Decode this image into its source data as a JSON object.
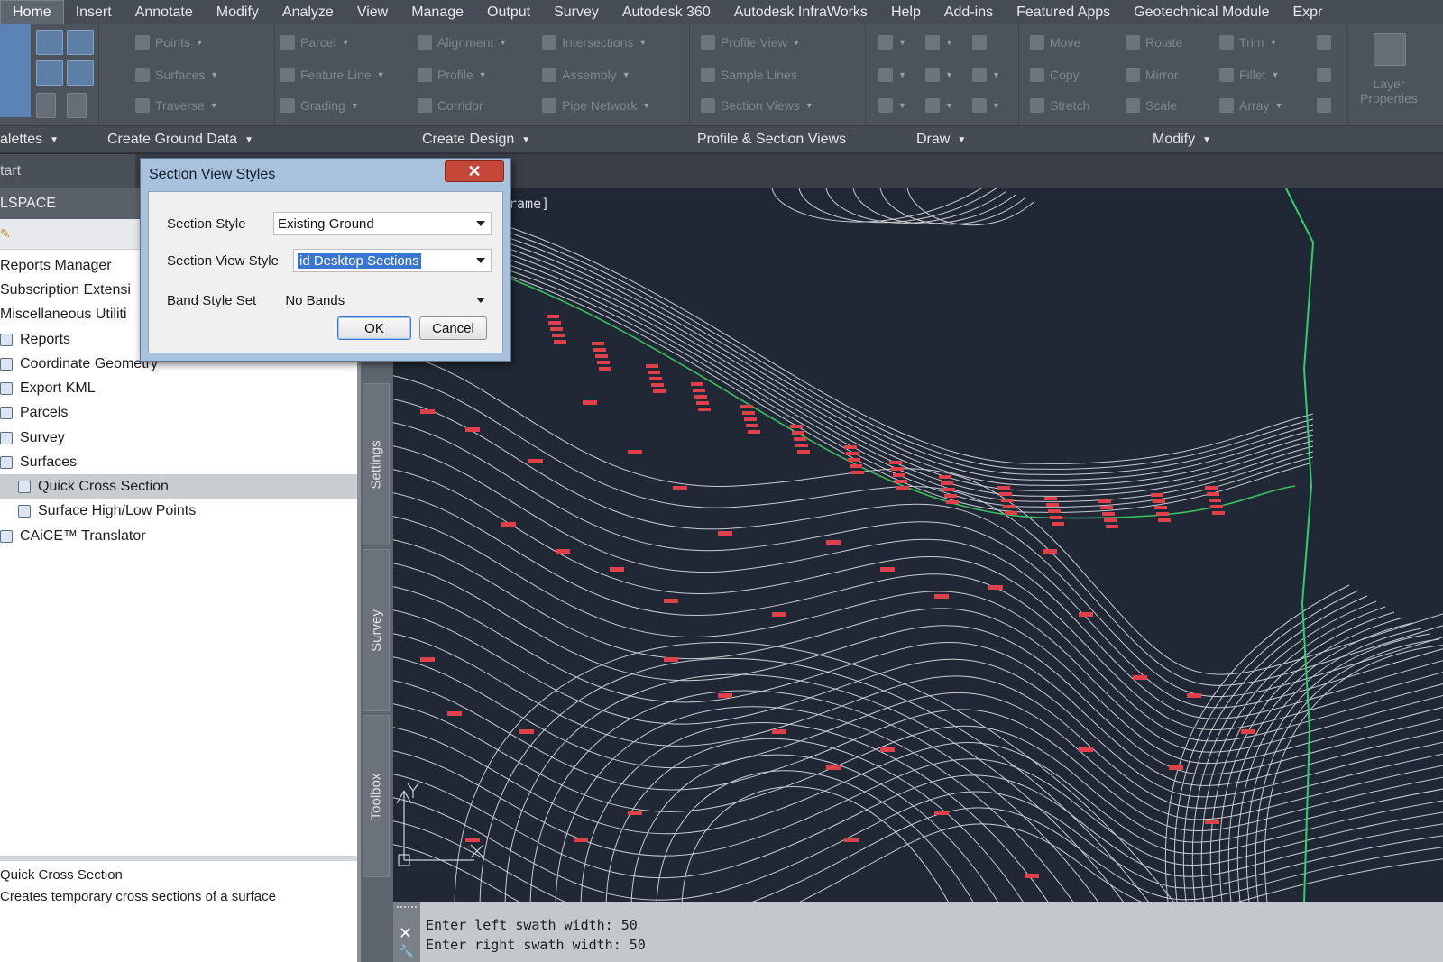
{
  "ribbon": {
    "tabs": [
      "Home",
      "Insert",
      "Annotate",
      "Modify",
      "Analyze",
      "View",
      "Manage",
      "Output",
      "Survey",
      "Autodesk 360",
      "Autodesk InfraWorks",
      "Help",
      "Add-ins",
      "Featured Apps",
      "Geotechnical Module",
      "Expr"
    ],
    "active_tab": "Home",
    "tools": {
      "points": "Points",
      "surfaces": "Surfaces",
      "traverse": "Traverse",
      "parcel": "Parcel",
      "feature_line": "Feature Line",
      "grading": "Grading",
      "alignment": "Alignment",
      "intersections": "Intersections",
      "profile": "Profile",
      "assembly": "Assembly",
      "corridor": "Corridor",
      "pipe_network": "Pipe Network",
      "profile_view": "Profile View",
      "sample_lines": "Sample Lines",
      "section_views": "Section Views",
      "move": "Move",
      "rotate": "Rotate",
      "trim": "Trim",
      "copy": "Copy",
      "mirror": "Mirror",
      "fillet": "Fillet",
      "stretch": "Stretch",
      "scale": "Scale",
      "array": "Array",
      "layer_properties_1": "Layer",
      "layer_properties_2": "Properties"
    },
    "panels": {
      "palettes": "alettes",
      "create_ground_data": "Create Ground Data",
      "create_design": "Create Design",
      "profile_section_views": "Profile & Section Views",
      "draw": "Draw",
      "modify": "Modify"
    }
  },
  "file_tabs": {
    "start": "tart"
  },
  "canvas": {
    "viewport_label": "rame]"
  },
  "toolspace": {
    "header": "LSPACE",
    "tree": [
      "Reports Manager",
      "Subscription Extensi",
      "Miscellaneous Utiliti",
      "Reports",
      "Coordinate Geometry",
      "Export KML",
      "Parcels",
      "Survey",
      "Surfaces",
      "Quick Cross Section",
      "Surface High/Low Points",
      "CAiCE™ Translator"
    ],
    "selected": "Quick Cross Section",
    "description_title": "Quick Cross Section",
    "description_text": "Creates temporary cross sections of a surface"
  },
  "side_tabs": {
    "settings": "Settings",
    "survey": "Survey",
    "toolbox": "Toolbox"
  },
  "dialog": {
    "title": "Section View Styles",
    "close_glyph": "✕",
    "section_style_label": "Section Style",
    "section_style_value": "Existing Ground",
    "section_view_style_label": "Section View Style",
    "section_view_style_value": "id Desktop Sections",
    "band_style_set_label": "Band Style Set",
    "band_style_set_value": "_No Bands",
    "ok": "OK",
    "cancel": "Cancel"
  },
  "command_line": {
    "history": [
      "Enter left swath width: 50",
      "Enter right swath width: 50"
    ]
  },
  "colors": {
    "canvas_bg": "#212835",
    "contour": "#c9cdd2",
    "label_red": "#e0404a",
    "boundary_green": "#2fcf6a",
    "alignment_green": "#3bbf5f"
  },
  "icons": [
    "pencil-icon",
    "close-icon",
    "wrench-icon",
    "ucs-icon",
    "dropdown-arrow-icon"
  ]
}
